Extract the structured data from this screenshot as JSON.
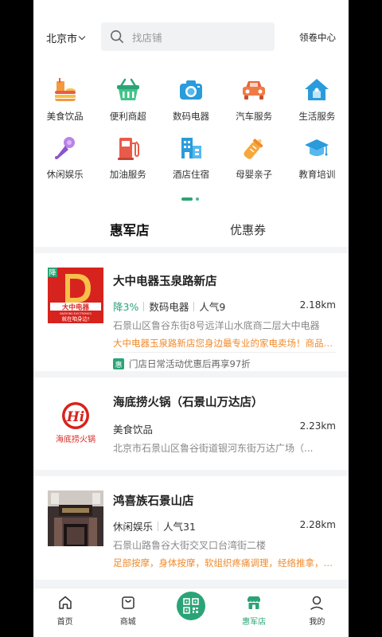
{
  "header": {
    "city": "北京市",
    "search_placeholder": "找店铺",
    "coupon_center": "领卷中心"
  },
  "categories": [
    {
      "label": "美食饮品",
      "icon": "food-drink-icon"
    },
    {
      "label": "便利商超",
      "icon": "shopping-basket-icon"
    },
    {
      "label": "数码电器",
      "icon": "camera-icon"
    },
    {
      "label": "汽车服务",
      "icon": "car-icon"
    },
    {
      "label": "生活服务",
      "icon": "home-service-icon"
    },
    {
      "label": "休闲娱乐",
      "icon": "microphone-icon"
    },
    {
      "label": "加油服务",
      "icon": "fuel-pump-icon"
    },
    {
      "label": "酒店住宿",
      "icon": "hotel-icon"
    },
    {
      "label": "母婴亲子",
      "icon": "baby-bottle-icon"
    },
    {
      "label": "教育培训",
      "icon": "graduation-cap-icon"
    }
  ],
  "tabs": {
    "active": "惠军店",
    "inactive": "优惠券"
  },
  "stores": [
    {
      "name": "大中电器玉泉路新店",
      "discount": "降3%",
      "category": "数码电器",
      "popularity": "人气9",
      "distance": "2.18km",
      "address": "石景山区鲁谷东街8号远洋山水底商二层大中电器",
      "description": "大中电器玉泉路新店您身边最专业的家电卖场！商品齐全",
      "promo": "门店日常活动优惠后再享97折",
      "corner_badge": "降",
      "logo_text_main": "大中电器",
      "logo_text_en": "DAZHONG ELECTRONICS",
      "logo_slogan": "就在咱身边!"
    },
    {
      "name": "海底捞火锅（石景山万达店）",
      "category": "美食饮品",
      "distance": "2.23km",
      "address": "北京市石景山区鲁谷街道银河东街万达广场（...",
      "logo_text": "海底捞火锅",
      "logo_mark": "Hi"
    },
    {
      "name": "鸿喜族石景山店",
      "category": "休闲娱乐",
      "popularity": "人气31",
      "distance": "2.28km",
      "address": "石景山路鲁谷大街交叉口台湾街二楼",
      "description": "足部按摩，身体按摩，软组织疼痛调理，经络推拿，采耳"
    }
  ],
  "nav": [
    {
      "label": "首页",
      "icon": "home-icon"
    },
    {
      "label": "商城",
      "icon": "shopping-bag-icon"
    },
    {
      "label": "",
      "icon": "qr-scan-icon"
    },
    {
      "label": "惠军店",
      "icon": "store-icon"
    },
    {
      "label": "我的",
      "icon": "profile-icon"
    }
  ],
  "colors": {
    "accent": "#2aa476",
    "orange": "#f08a2c"
  }
}
